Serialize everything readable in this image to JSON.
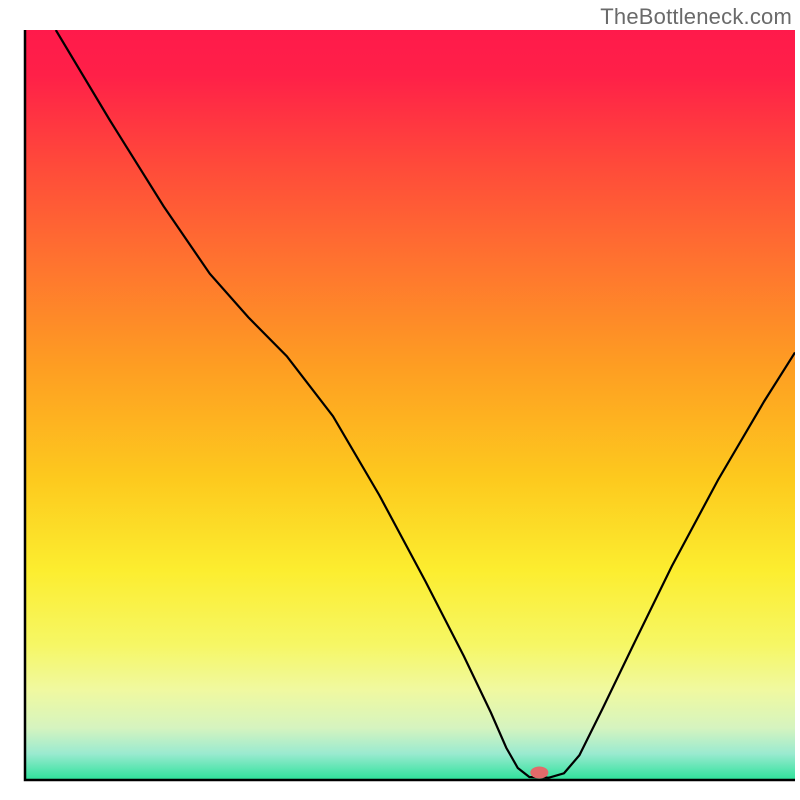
{
  "watermark": "TheBottleneck.com",
  "chart_data": {
    "type": "line",
    "title": "",
    "xlabel": "",
    "ylabel": "",
    "xlim": [
      0,
      100
    ],
    "ylim": [
      0,
      100
    ],
    "background_gradient": {
      "stops": [
        {
          "offset": 0.0,
          "color": "#ff1a4b"
        },
        {
          "offset": 0.06,
          "color": "#ff2048"
        },
        {
          "offset": 0.18,
          "color": "#ff4a3a"
        },
        {
          "offset": 0.3,
          "color": "#ff7030"
        },
        {
          "offset": 0.45,
          "color": "#fe9e22"
        },
        {
          "offset": 0.6,
          "color": "#fdca1e"
        },
        {
          "offset": 0.72,
          "color": "#fced2f"
        },
        {
          "offset": 0.82,
          "color": "#f6f765"
        },
        {
          "offset": 0.88,
          "color": "#f0f9a0"
        },
        {
          "offset": 0.93,
          "color": "#d6f4bf"
        },
        {
          "offset": 0.965,
          "color": "#9aead0"
        },
        {
          "offset": 1.0,
          "color": "#2de29a"
        }
      ]
    },
    "curve": [
      {
        "x": 4.0,
        "y": 100.0
      },
      {
        "x": 11.0,
        "y": 88.0
      },
      {
        "x": 18.0,
        "y": 76.5
      },
      {
        "x": 24.0,
        "y": 67.5
      },
      {
        "x": 29.0,
        "y": 61.7
      },
      {
        "x": 34.0,
        "y": 56.5
      },
      {
        "x": 40.0,
        "y": 48.5
      },
      {
        "x": 46.0,
        "y": 38.0
      },
      {
        "x": 52.0,
        "y": 26.5
      },
      {
        "x": 57.0,
        "y": 16.5
      },
      {
        "x": 60.5,
        "y": 9.0
      },
      {
        "x": 62.5,
        "y": 4.3
      },
      {
        "x": 64.0,
        "y": 1.6
      },
      {
        "x": 65.5,
        "y": 0.4
      },
      {
        "x": 68.0,
        "y": 0.3
      },
      {
        "x": 70.0,
        "y": 0.9
      },
      {
        "x": 72.0,
        "y": 3.3
      },
      {
        "x": 75.0,
        "y": 9.5
      },
      {
        "x": 79.0,
        "y": 18.0
      },
      {
        "x": 84.0,
        "y": 28.5
      },
      {
        "x": 90.0,
        "y": 40.0
      },
      {
        "x": 96.0,
        "y": 50.5
      },
      {
        "x": 100.0,
        "y": 57.0
      }
    ],
    "marker": {
      "x": 66.8,
      "y": 1.0,
      "color": "#e26a6a",
      "rx": 9,
      "ry": 6
    },
    "frame_color": "#000000",
    "curve_color": "#000000"
  }
}
